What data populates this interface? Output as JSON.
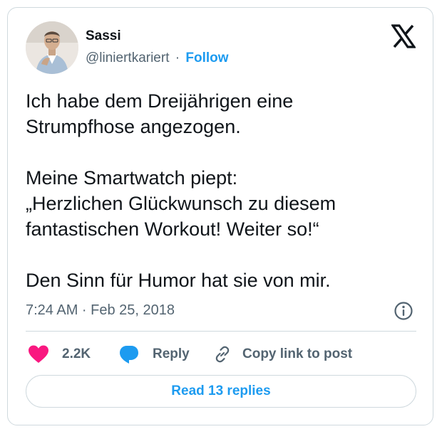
{
  "author": {
    "name": "Sassi",
    "handle": "@liniertkariert",
    "separator": "·",
    "follow_label": "Follow"
  },
  "tweet": {
    "lines": [
      "Ich habe dem Dreijährigen eine",
      "Strumpfhose angezogen.",
      "",
      "Meine Smartwatch piept:",
      "„Herzlichen Glückwunsch zu diesem",
      "fantastischen Workout! Weiter so!“",
      "",
      "Den Sinn für Humor hat sie von mir."
    ],
    "timestamp": "7:24 AM · Feb 25, 2018"
  },
  "actions": {
    "like_count": "2.2K",
    "reply_label": "Reply",
    "copy_link_label": "Copy link to post",
    "read_replies_label": "Read 13 replies"
  },
  "icons": {
    "platform_logo": "x-logo-icon",
    "info": "info-icon",
    "like": "heart-icon",
    "reply": "speech-bubble-icon",
    "copy_link": "link-icon"
  },
  "colors": {
    "accent": "#1d9bf0",
    "like": "#f91880",
    "text_primary": "#0f1419",
    "text_secondary": "#536471",
    "border": "#cfd9de"
  }
}
